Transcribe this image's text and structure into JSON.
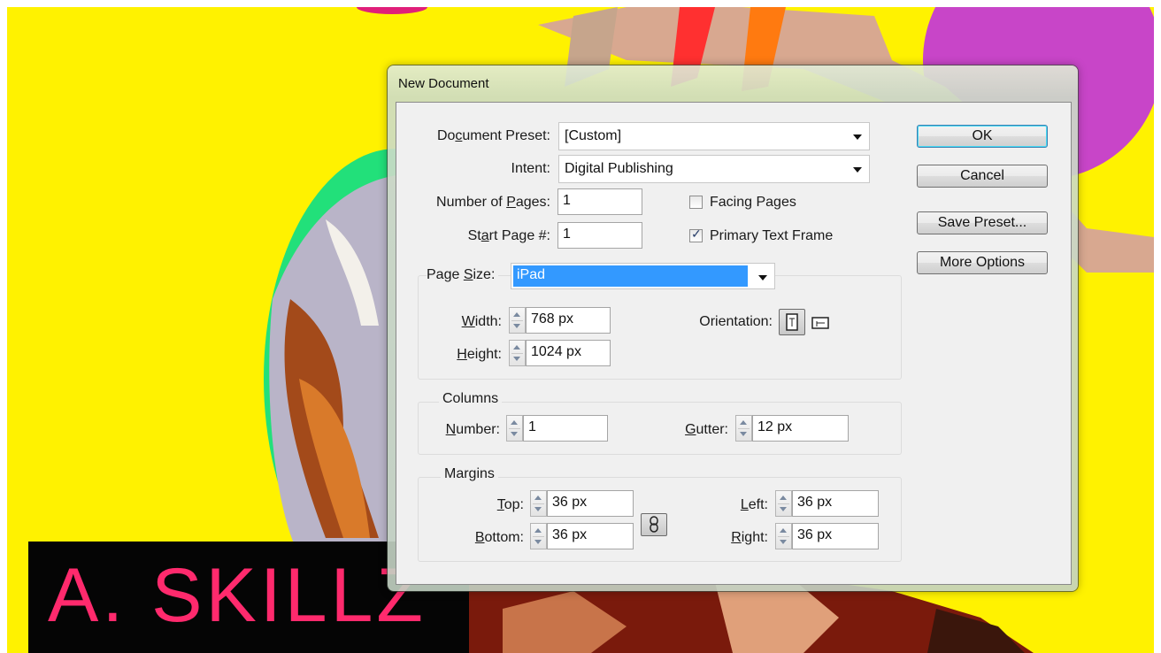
{
  "background": {
    "colors": {
      "yellow": "#fff200",
      "pink": "#ff2a6d",
      "magenta": "#cc33cc",
      "green": "#22e07a"
    },
    "art_text": "A. SKILLZ"
  },
  "dialog": {
    "title": "New Document",
    "document_preset": {
      "label_pre": "Do",
      "label_u": "c",
      "label_post": "ument Preset:",
      "value": "[Custom]"
    },
    "intent": {
      "label": "Intent:",
      "value": "Digital Publishing"
    },
    "number_of_pages": {
      "label_pre": "Number of ",
      "label_u": "P",
      "label_post": "ages:",
      "value": "1"
    },
    "start_page": {
      "label_pre": "St",
      "label_u": "a",
      "label_post": "rt Page #:",
      "value": "1"
    },
    "facing_pages": {
      "label": "Facing Pages",
      "checked": false
    },
    "primary_text_frame": {
      "label": "Primary Text Frame",
      "checked": true,
      "mark": "✓"
    },
    "page_size": {
      "label_pre": "Page ",
      "label_u": "S",
      "label_post": "ize:",
      "value": "iPad",
      "width": {
        "label_pre": "",
        "label_u": "W",
        "label_post": "idth:",
        "value": "768 px"
      },
      "height": {
        "label_pre": "",
        "label_u": "H",
        "label_post": "eight:",
        "value": "1024 px"
      },
      "orientation": {
        "label": "Orientation:",
        "selected": "portrait"
      }
    },
    "columns": {
      "title": "Columns",
      "number": {
        "label_pre": "",
        "label_u": "N",
        "label_post": "umber:",
        "value": "1"
      },
      "gutter": {
        "label_pre": "",
        "label_u": "G",
        "label_post": "utter:",
        "value": "12 px"
      }
    },
    "margins": {
      "title": "Margins",
      "top": {
        "label_pre": "",
        "label_u": "T",
        "label_post": "op:",
        "value": "36 px"
      },
      "bottom": {
        "label_pre": "",
        "label_u": "B",
        "label_post": "ottom:",
        "value": "36 px"
      },
      "left": {
        "label_pre": "",
        "label_u": "L",
        "label_post": "eft:",
        "value": "36 px"
      },
      "right": {
        "label_pre": "",
        "label_u": "R",
        "label_post": "ight:",
        "value": "36 px"
      },
      "link_icon": "chain-link-icon"
    },
    "buttons": {
      "ok": "OK",
      "cancel": "Cancel",
      "save_preset": "Save Preset...",
      "more_options": "More Options"
    }
  }
}
